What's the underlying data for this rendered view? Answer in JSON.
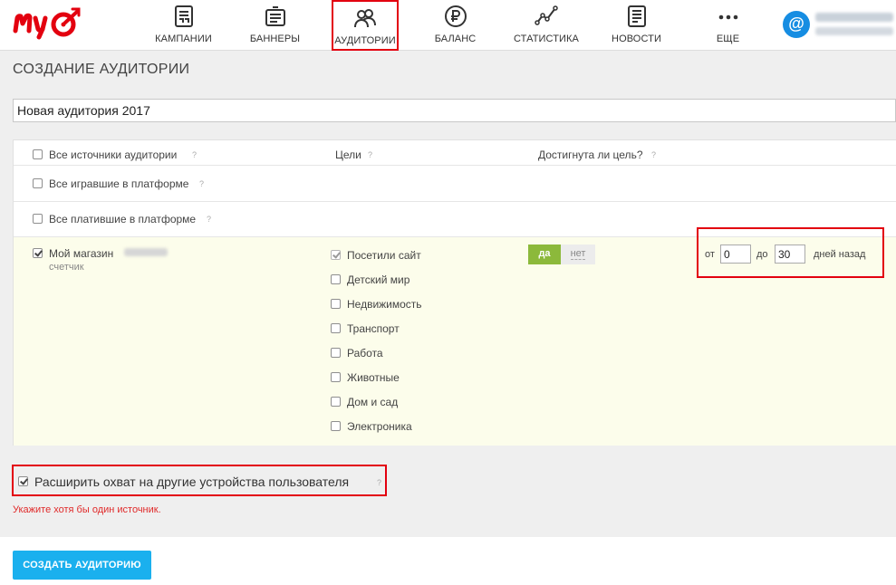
{
  "nav": {
    "items": [
      {
        "label": "КАМПАНИИ",
        "icon": "campaigns-icon"
      },
      {
        "label": "БАННЕРЫ",
        "icon": "banners-icon"
      },
      {
        "label": "АУДИТОРИИ",
        "icon": "audiences-icon",
        "active": true
      },
      {
        "label": "БАЛАНС",
        "icon": "balance-icon"
      },
      {
        "label": "СТАТИСТИКА",
        "icon": "statistics-icon"
      },
      {
        "label": "НОВОСТИ",
        "icon": "news-icon"
      },
      {
        "label": "ЕЩЕ",
        "icon": "more-icon"
      }
    ]
  },
  "page": {
    "title": "СОЗДАНИЕ АУДИТОРИИ",
    "audience_name": "Новая аудитория 2017"
  },
  "sources": {
    "header": {
      "all_sources": "Все источники аудитории",
      "goals": "Цели",
      "goal_reached": "Достигнута ли цель?",
      "help": "?"
    },
    "played": "Все игравшие в платформе",
    "paid": "Все платившие в платформе",
    "shop": {
      "name": "Мой магазин",
      "type": "счетчик",
      "checked": true
    },
    "goals": [
      {
        "label": "Посетили сайт",
        "checked": true
      },
      {
        "label": "Детский мир",
        "checked": false
      },
      {
        "label": "Недвижимость",
        "checked": false
      },
      {
        "label": "Транспорт",
        "checked": false
      },
      {
        "label": "Работа",
        "checked": false
      },
      {
        "label": "Животные",
        "checked": false
      },
      {
        "label": "Дом и сад",
        "checked": false
      },
      {
        "label": "Электроника",
        "checked": false
      }
    ],
    "reached": {
      "yes": "да",
      "no": "нет",
      "selected": "yes"
    },
    "days": {
      "from_label": "от",
      "from_value": "0",
      "to_label": "до",
      "to_value": "30",
      "suffix": "дней назад"
    }
  },
  "expand": {
    "label": "Расширить охват на другие устройства пользователя",
    "checked": true,
    "help": "?"
  },
  "error": "Укажите хотя бы один источник.",
  "create_button": "СОЗДАТЬ АУДИТОРИЮ",
  "colors": {
    "accent": "#1ab0ee",
    "highlight": "#e3000f",
    "yes": "#8cb93b",
    "error": "#e02a2a",
    "section_bg": "#fcfdeb"
  }
}
